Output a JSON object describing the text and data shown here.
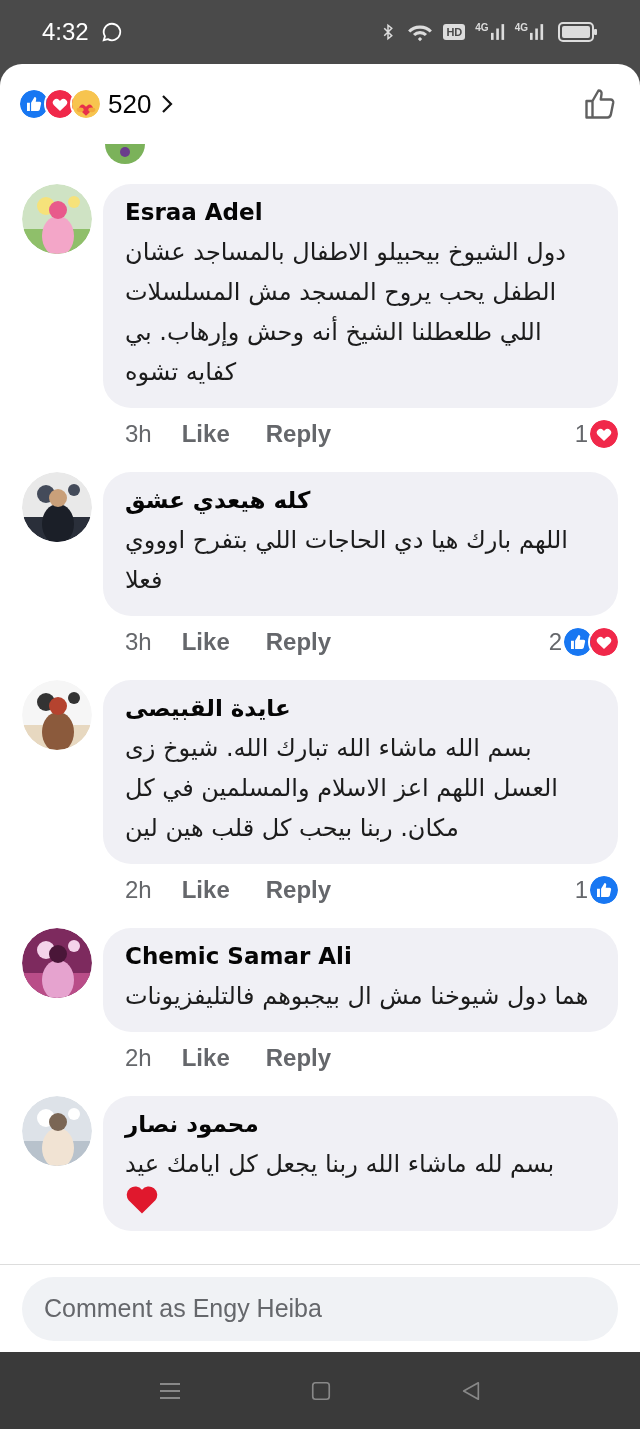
{
  "status_bar": {
    "time": "4:32",
    "hd": "HD",
    "sim_1_network": "4G",
    "sim_2_network": "4G"
  },
  "reactions_header": {
    "reactions": [
      {
        "kind": "like"
      },
      {
        "kind": "love"
      },
      {
        "kind": "care"
      }
    ],
    "count": "520"
  },
  "comments": [
    {
      "author": "Esraa Adel",
      "text": "دول الشيوخ بيحبيلو الاطفال بالمساجد عشان الطفل يحب يروح المسجد مش المسلسلات اللي طلعطلنا الشيخ أنه وحش وإرهاب. بي كفايه تشوه",
      "time": "3h",
      "like": "Like",
      "reply": "Reply",
      "reaction_count": "1",
      "reactions": [
        {
          "kind": "love"
        }
      ],
      "trailing_heart": false
    },
    {
      "author": "كله هيعدي عشق",
      "text": "اللهم بارك هيا دي الحاجات اللي بتفرح اوووي فعلا",
      "time": "3h",
      "like": "Like",
      "reply": "Reply",
      "reaction_count": "2",
      "reactions": [
        {
          "kind": "like"
        },
        {
          "kind": "love"
        }
      ],
      "trailing_heart": false
    },
    {
      "author": "عايدة القبيصى",
      "text": "بسم الله ماشاء الله تبارك الله. شيوخ زى العسل اللهم اعز الاسلام والمسلمين في كل مكان.  ربنا بيحب كل  قلب هين لين",
      "time": "2h",
      "like": "Like",
      "reply": "Reply",
      "reaction_count": "1",
      "reactions": [
        {
          "kind": "like"
        }
      ],
      "trailing_heart": false
    },
    {
      "author": "Chemic Samar Ali",
      "text": "هما دول شيوخنا مش ال بيجبوهم فالتليفزيونات",
      "time": "2h",
      "like": "Like",
      "reply": "Reply",
      "trailing_heart": false
    },
    {
      "author": "محمود نصار",
      "text": "بسم لله ماشاء الله ربنا يجعل كل ايامك عيد",
      "trailing_heart": true
    }
  ],
  "comment_field": {
    "placeholder": "Comment as Engy Heiba"
  }
}
